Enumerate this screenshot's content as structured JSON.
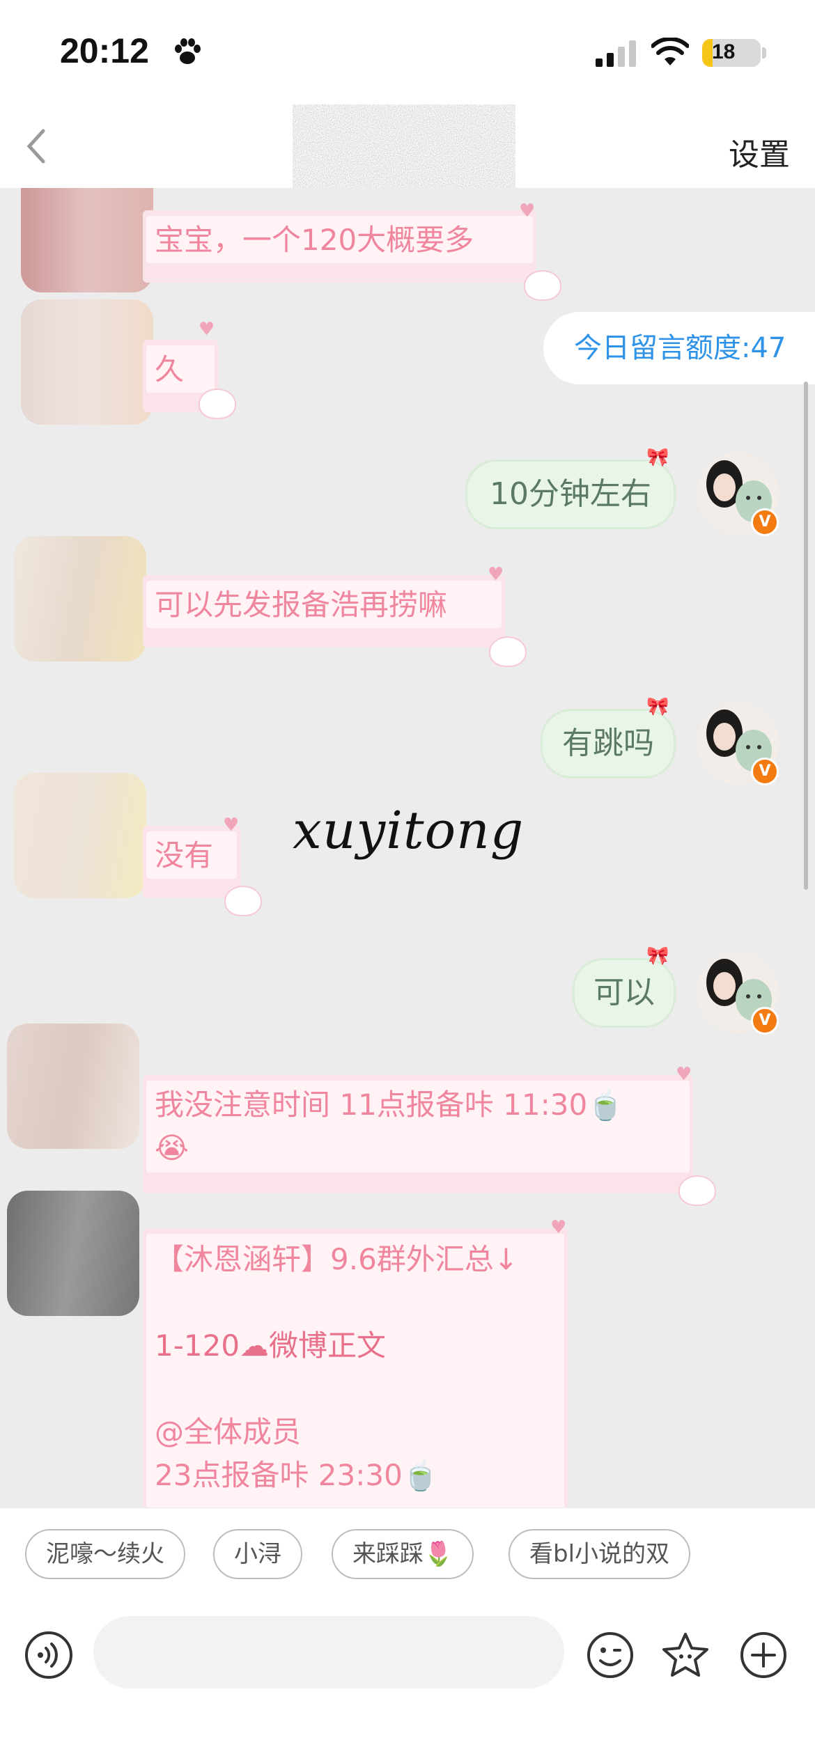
{
  "status_bar": {
    "time": "20:12",
    "battery_level": "18",
    "battery_fraction": 0.18,
    "icons": [
      "paw-icon",
      "cellular-signal-icon",
      "wifi-icon",
      "battery-icon"
    ]
  },
  "nav": {
    "back_icon": "chevron-left-icon",
    "settings_label": "设置"
  },
  "chat": {
    "quota_label": "今日留言额度:47",
    "messages": [
      {
        "side": "in",
        "text": "宝宝，一个120大概要多"
      },
      {
        "side": "in",
        "text": "久"
      },
      {
        "side": "out",
        "text": "10分钟左右"
      },
      {
        "side": "in",
        "text": "可以先发报备浩再捞嘛"
      },
      {
        "side": "out",
        "text": "有跳吗"
      },
      {
        "side": "in",
        "text": "没有"
      },
      {
        "side": "out",
        "text": "可以"
      },
      {
        "side": "in",
        "text": "我没注意时间 11点报备咔 11:30🍵",
        "text2": "😭"
      },
      {
        "side": "in",
        "lines": [
          "【沐恩涵轩】9.6群外汇总↓",
          "",
          "1-120☁微博正文",
          "",
          "@全体成员",
          "23点报备咔  23:30🍵"
        ]
      }
    ],
    "signature_text": "xuyitong"
  },
  "chips": [
    "泥嚎～续火",
    "小浔",
    "来踩踩🌷",
    "看bl小说的双"
  ],
  "input_bar": {
    "placeholder": "",
    "icons": [
      "voice-icon",
      "emoji-icon",
      "star-sticker-icon",
      "plus-icon"
    ]
  },
  "colors": {
    "incoming_text": "#f0869d",
    "outgoing_text": "#5b7a63",
    "quota_text": "#2e93e8",
    "badge": "#f37b12",
    "chat_background": "#ececec"
  }
}
